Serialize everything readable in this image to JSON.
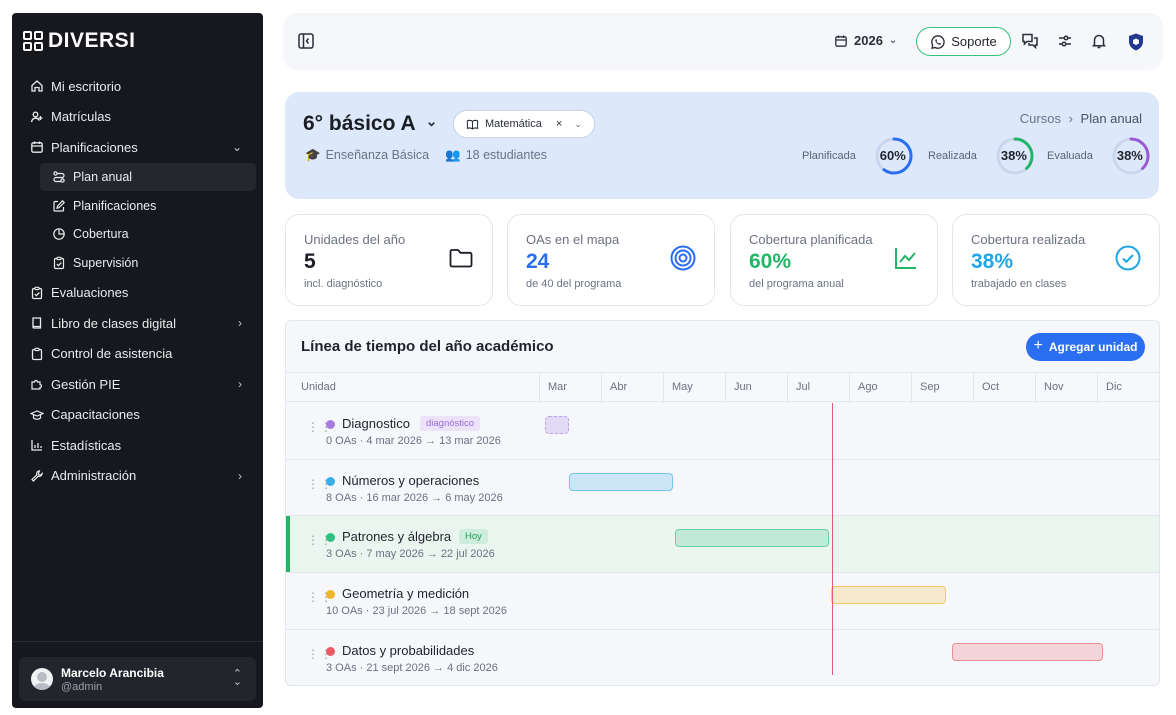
{
  "brand": {
    "name": "DIVERSI"
  },
  "sidebar": {
    "items": [
      {
        "label": "Mi escritorio",
        "icon": "home-icon"
      },
      {
        "label": "Matrículas",
        "icon": "user-plus-icon"
      },
      {
        "label": "Planificaciones",
        "icon": "calendar-icon"
      },
      {
        "label": "Evaluaciones",
        "icon": "clipboard-icon"
      },
      {
        "label": "Libro de clases digital",
        "icon": "book-icon"
      },
      {
        "label": "Control de asistencia",
        "icon": "clipboard-check-icon"
      },
      {
        "label": "Gestión PIE",
        "icon": "puzzle-icon"
      },
      {
        "label": "Capacitaciones",
        "icon": "graduation-cap-icon"
      },
      {
        "label": "Estadísticas",
        "icon": "bar-chart-icon"
      },
      {
        "label": "Administración",
        "icon": "wrench-icon"
      }
    ],
    "subitems": [
      {
        "label": "Plan anual",
        "icon": "route-icon"
      },
      {
        "label": "Planificaciones",
        "icon": "edit-icon"
      },
      {
        "label": "Cobertura",
        "icon": "pie-icon"
      },
      {
        "label": "Supervisión",
        "icon": "clipboard-check-icon"
      }
    ],
    "user": {
      "name": "Marcelo Arancibia",
      "handle": "@admin"
    }
  },
  "topbar": {
    "year": "2026",
    "support_label": "Soporte"
  },
  "header": {
    "course": "6° básico A",
    "subject": "Matemática",
    "level": "Enseñanza Básica",
    "students": "18 estudiantes",
    "breadcrumb_root": "Cursos",
    "breadcrumb_sep": "›",
    "breadcrumb_current": "Plan anual",
    "gauges": [
      {
        "label": "Planificada",
        "value": "60%",
        "fraction": 0.6,
        "color": "#2a6ef2"
      },
      {
        "label": "Realizada",
        "value": "38%",
        "fraction": 0.38,
        "color": "#22b566"
      },
      {
        "label": "Evaluada",
        "value": "38%",
        "fraction": 0.38,
        "color": "#9b59d6"
      }
    ]
  },
  "stats": [
    {
      "label": "Unidades del año",
      "value": "5",
      "sub": "incl. diagnóstico",
      "color": "#1a1d24",
      "icon": "folder-icon"
    },
    {
      "label": "OAs en el mapa",
      "value": "24",
      "sub": "de 40 del programa",
      "color": "#2a6ef2",
      "icon": "target-icon"
    },
    {
      "label": "Cobertura planificada",
      "value": "60%",
      "sub": "del programa anual",
      "color": "#22b566",
      "icon": "trend-chart-icon"
    },
    {
      "label": "Cobertura realizada",
      "value": "38%",
      "sub": "trabajado en clases",
      "color": "#1fa6e6",
      "icon": "check-circle-icon"
    }
  ],
  "timeline": {
    "title": "Línea de tiempo del año académico",
    "add_label": "Agregar unidad",
    "unit_header": "Unidad",
    "months": [
      "Mar",
      "Abr",
      "May",
      "Jun",
      "Jul",
      "Ago",
      "Sep",
      "Oct",
      "Nov",
      "Dic"
    ],
    "rows": [
      {
        "name": "Diagnostico",
        "badge": "diagnóstico",
        "meta": "0 OAs · 4 mar 2026 → 13 mar 2026",
        "color": "#a57be0",
        "start": "2026-03-04",
        "end": "2026-03-13"
      },
      {
        "name": "Números y operaciones",
        "badge": "",
        "meta": "8 OAs · 16 mar 2026 → 6 may 2026",
        "color": "#3aaee6",
        "start": "2026-03-16",
        "end": "2026-05-06"
      },
      {
        "name": "Patrones y álgebra",
        "badge": "Hoy",
        "meta": "3 OAs · 7 may 2026 → 22 jul 2026",
        "color": "#2ec27e",
        "start": "2026-05-07",
        "end": "2026-07-22"
      },
      {
        "name": "Geometría y medición",
        "badge": "",
        "meta": "10 OAs · 23 jul 2026 → 18 sept 2026",
        "color": "#f0b429",
        "start": "2026-07-23",
        "end": "2026-09-18"
      },
      {
        "name": "Datos y probabilidades",
        "badge": "",
        "meta": "3 OAs · 21 sept 2026 → 4 dic 2026",
        "color": "#ec5b64",
        "start": "2026-09-21",
        "end": "2026-12-04"
      }
    ]
  }
}
